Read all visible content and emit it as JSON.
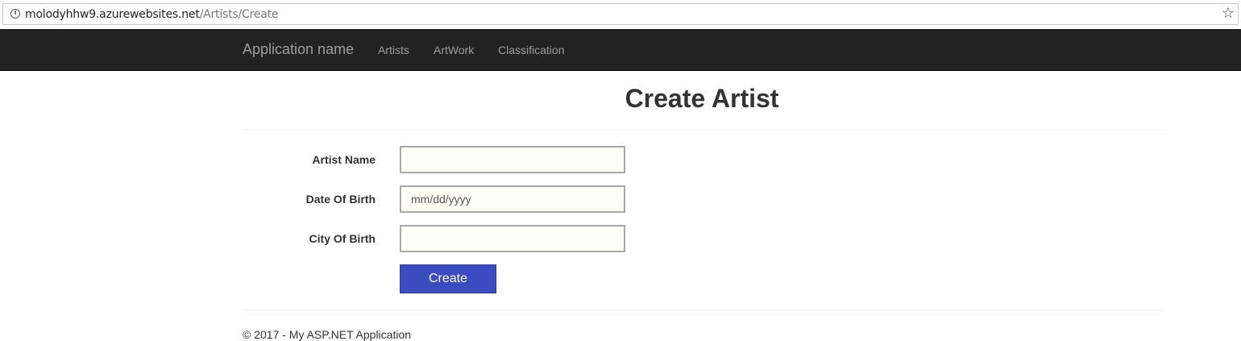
{
  "browser": {
    "url_host": "molodyhhw9.azurewebsites.net",
    "url_path": "/Artists/Create"
  },
  "navbar": {
    "brand": "Application name",
    "links": [
      "Artists",
      "ArtWork",
      "Classification"
    ]
  },
  "main": {
    "title": "Create Artist",
    "fields": [
      {
        "label": "Artist Name",
        "value": "",
        "placeholder": ""
      },
      {
        "label": "Date Of Birth",
        "value": "",
        "placeholder": "mm/dd/yyyy"
      },
      {
        "label": "City Of Birth",
        "value": "",
        "placeholder": ""
      }
    ],
    "submit_label": "Create"
  },
  "footer": {
    "text": "© 2017 - My ASP.NET Application"
  },
  "colors": {
    "navbar_bg": "#222222",
    "nav_text": "#9d9d9d",
    "button_bg": "#3b4cc0",
    "input_bg": "#fffff7"
  }
}
